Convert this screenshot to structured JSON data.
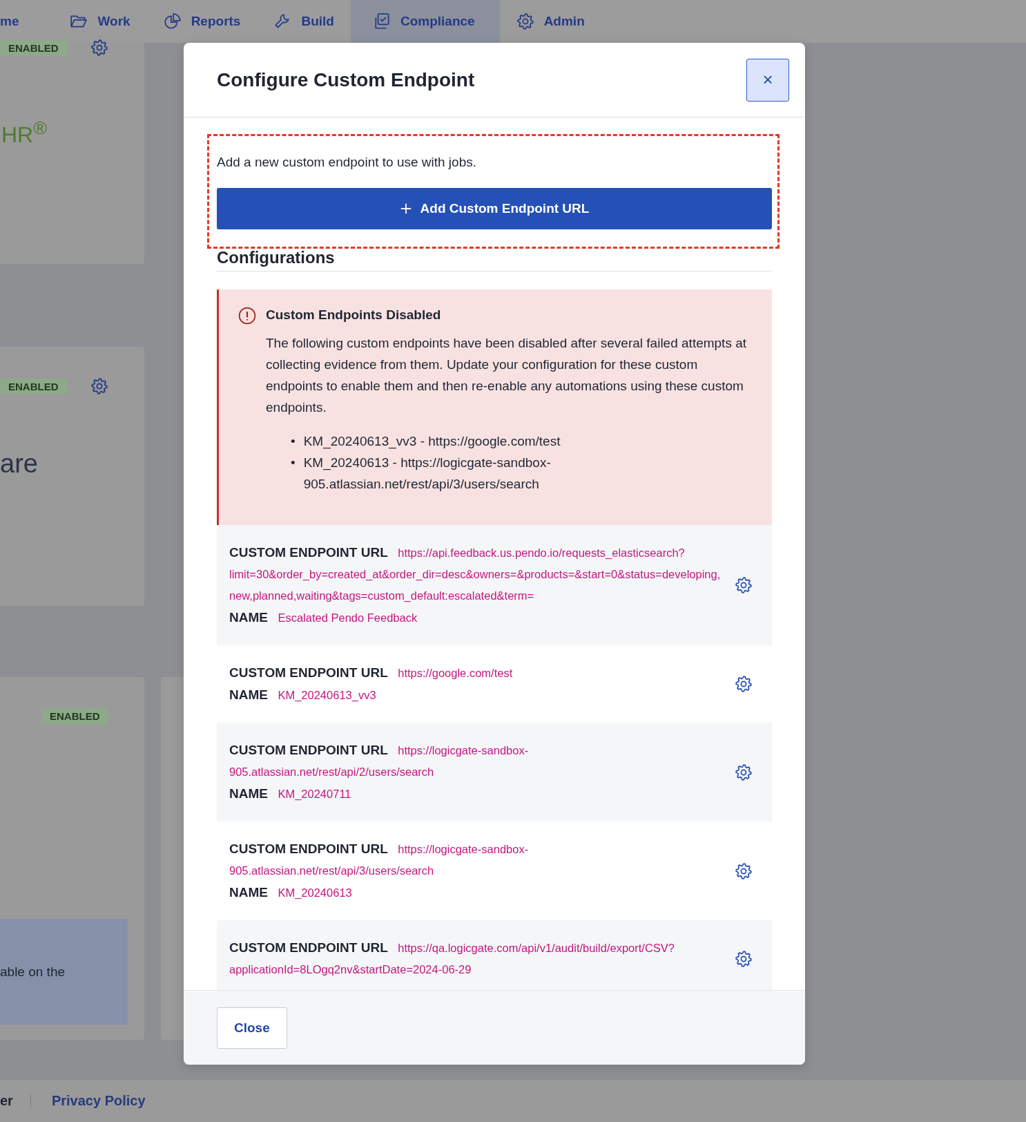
{
  "nav": {
    "items": [
      {
        "label": "me",
        "selected": false
      },
      {
        "label": "Work",
        "selected": false
      },
      {
        "label": "Reports",
        "selected": false
      },
      {
        "label": "Build",
        "selected": false
      },
      {
        "label": "Compliance",
        "selected": true
      },
      {
        "label": "Admin",
        "selected": false
      }
    ]
  },
  "background": {
    "cards": [
      {
        "badge": "ENABLED",
        "gear": true,
        "logo": "HR$^{®}$"
      },
      {
        "badge": "ENABLED",
        "gear": true,
        "heading": "are"
      },
      {
        "badge": "ENABLED",
        "gear": false,
        "note": "able on the"
      }
    ]
  },
  "modal": {
    "title": "Configure Custom Endpoint",
    "close": "×",
    "description": "Add a new custom endpoint to use with jobs.",
    "add_button": "Add Custom Endpoint URL",
    "section_heading": "Configurations",
    "alert": {
      "title": "Custom Endpoints Disabled",
      "body": "The following custom endpoints have been disabled after several failed attempts at collecting evidence from them. Update your configuration for these custom endpoints to enable them and then re-enable any automations using these custom endpoints.",
      "items": [
        {
          "bullet": "•",
          "text": "KM_20240613_vv3 - https://google.com/test"
        },
        {
          "bullet": "•",
          "text": "KM_20240613 - https://logicgate-sandbox-905.atlassian.net/rest/api/3/users/search"
        }
      ]
    },
    "endpoints": [
      {
        "url_label": "CUSTOM ENDPOINT URL",
        "url": "https://api.feedback.us.pendo.io/requests_elasticsearch?limit=30&order_by=created_at&order_dir=desc&owners=&products=&start=0&status=developing,new,planned,waiting&tags=custom_default:escalated&term=",
        "name_label": "NAME",
        "name": "Escalated Pendo Feedback"
      },
      {
        "url_label": "CUSTOM ENDPOINT URL",
        "url": "https://google.com/test",
        "name_label": "NAME",
        "name": "KM_20240613_vv3"
      },
      {
        "url_label": "CUSTOM ENDPOINT URL",
        "url": "https://logicgate-sandbox-905.atlassian.net/rest/api/2/users/search",
        "name_label": "NAME",
        "name": "KM_20240711"
      },
      {
        "url_label": "CUSTOM ENDPOINT URL",
        "url": "https://logicgate-sandbox-905.atlassian.net/rest/api/3/users/search",
        "name_label": "NAME",
        "name": "KM_20240613"
      },
      {
        "url_label": "CUSTOM ENDPOINT URL",
        "url": "https://qa.logicgate.com/api/v1/audit/build/export/CSV?applicationId=8LOgq2nv&startDate=2024-06-29"
      }
    ],
    "footer_button": "Close"
  },
  "page_footer": {
    "links": [
      "er",
      "Privacy Policy"
    ]
  }
}
